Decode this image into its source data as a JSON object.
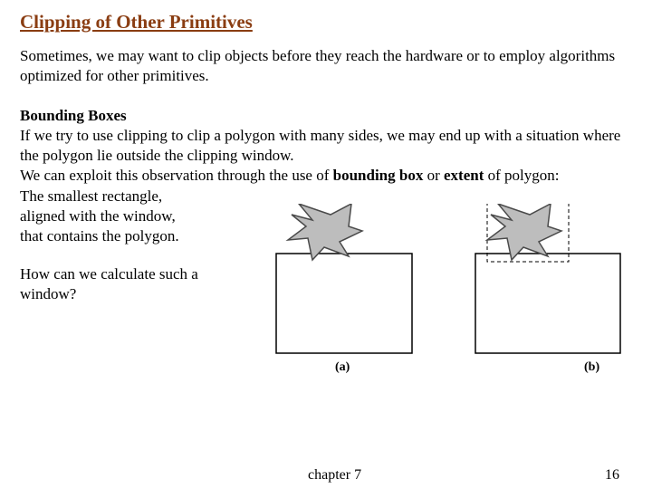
{
  "title": "Clipping of Other Primitives",
  "intro": "Sometimes, we may want to clip objects before they reach the hardware or to employ algorithms optimized for other primitives.",
  "section": {
    "heading": "Bounding Boxes",
    "p1": "If we try to use clipping to clip a polygon with many sides, we may end up with a situation where the polygon lie outside the clipping window.",
    "p2_prefix": "We can exploit this observation through the use of ",
    "p2_bold1": "bounding box",
    "p2_mid": " or ",
    "p2_bold2": "extent",
    "p2_suffix": " of polygon:",
    "p3a": "The smallest rectangle,",
    "p3b": "aligned with the window,",
    "p3c": "that contains the polygon."
  },
  "question": "How can we calculate such a window?",
  "figure": {
    "label_a": "(a)",
    "label_b": "(b)"
  },
  "footer": {
    "chapter": "chapter 7",
    "page": "16"
  }
}
